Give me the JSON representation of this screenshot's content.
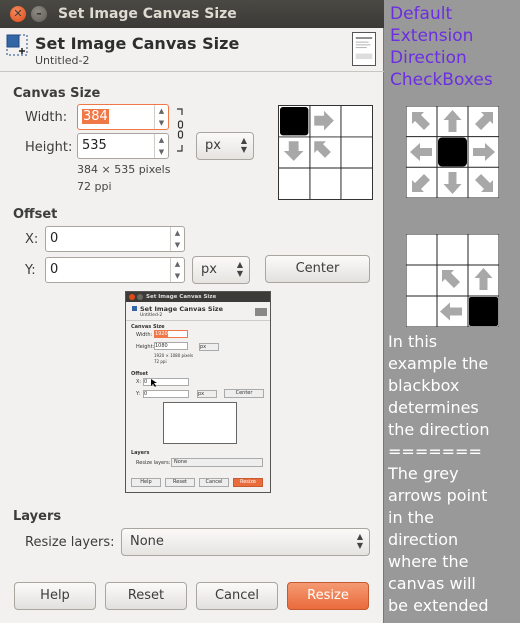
{
  "window": {
    "title": "Set Image Canvas Size",
    "close_glyph": "✕",
    "minimize_glyph": "–"
  },
  "header": {
    "title": "Set Image Canvas Size",
    "subtitle": "Untitled-2",
    "icon": "canvas-size-icon"
  },
  "canvas_size": {
    "section_label": "Canvas Size",
    "width_label": "Width:",
    "width_value": "384",
    "height_label": "Height:",
    "height_value": "535",
    "unit": "px",
    "info_pixels": "384 × 535 pixels",
    "info_ppi": "72 ppi"
  },
  "offset": {
    "section_label": "Offset",
    "x_label": "X:",
    "x_value": "0",
    "y_label": "Y:",
    "y_value": "0",
    "unit": "px",
    "center_label": "Center"
  },
  "preview": {
    "title": "Set Image Canvas Size",
    "subtitle": "Untitled-2",
    "section_canvas": "Canvas Size",
    "width_label": "Width:",
    "width_value": "1920",
    "height_label": "Height:",
    "height_value": "1080",
    "unit": "px",
    "info_pixels": "1920 × 1080 pixels",
    "info_ppi": "72 ppi",
    "section_offset": "Offset",
    "x_label": "X:",
    "x_value": "0",
    "y_label": "Y:",
    "y_value": "0",
    "center_label": "Center",
    "section_layers": "Layers",
    "resize_label": "Resize layers:",
    "resize_value": "None",
    "help": "Help",
    "reset": "Reset",
    "cancel": "Cancel",
    "resize": "Resize"
  },
  "layers": {
    "section_label": "Layers",
    "resize_label": "Resize layers:",
    "resize_value": "None"
  },
  "buttons": {
    "help": "Help",
    "reset": "Reset",
    "cancel": "Cancel",
    "resize": "Resize"
  },
  "annotations": {
    "heading_lines": [
      "Default",
      "Extension",
      "Direction",
      "CheckBoxes"
    ],
    "explanation_lines": [
      "In this",
      "example the",
      "blackbox",
      "determines",
      "the direction",
      "=======",
      "The grey",
      "arrows point",
      "in the",
      "direction",
      "where the",
      "canvas will",
      "be extended"
    ],
    "heading_color": "#6b2ee0"
  },
  "colors": {
    "accent": "#ea6b3c",
    "selection": "#f07746",
    "arrow_grey": "#a8a8a8"
  }
}
